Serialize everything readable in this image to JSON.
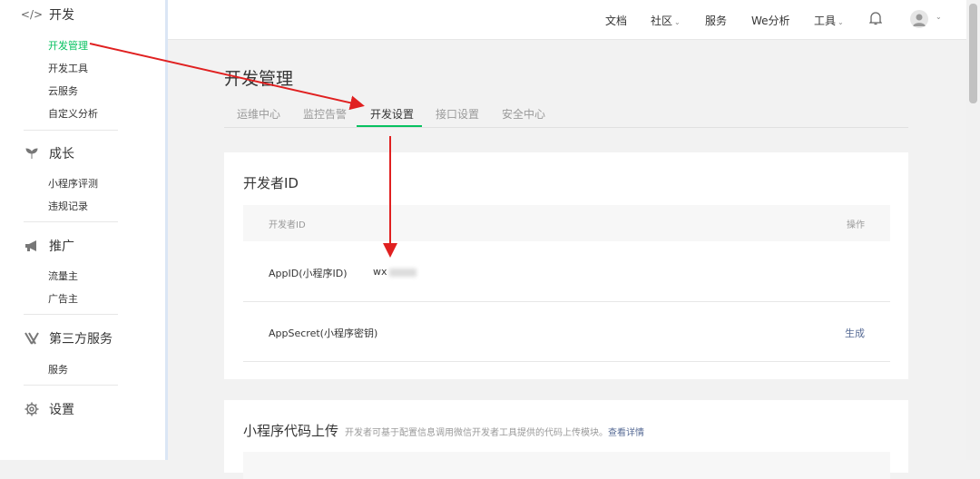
{
  "sidebar": {
    "sections": [
      {
        "title": "开发",
        "icon": "code-icon",
        "items": [
          "开发管理",
          "开发工具",
          "云服务",
          "自定义分析"
        ]
      },
      {
        "title": "成长",
        "icon": "sprout-icon",
        "items": [
          "小程序评测",
          "违规记录"
        ]
      },
      {
        "title": "推广",
        "icon": "megaphone-icon",
        "items": [
          "流量主",
          "广告主"
        ]
      },
      {
        "title": "第三方服务",
        "icon": "third-party-icon",
        "items": [
          "服务"
        ]
      },
      {
        "title": "设置",
        "icon": "gear-icon",
        "items": []
      }
    ],
    "active_item": "开发管理"
  },
  "topbar": {
    "items": [
      "文档",
      "社区",
      "服务",
      "We分析",
      "工具"
    ],
    "bell_icon": "bell-icon",
    "avatar_icon": "user-avatar-icon"
  },
  "page": {
    "title": "开发管理",
    "tabs": [
      "运维中心",
      "监控告警",
      "开发设置",
      "接口设置",
      "安全中心"
    ],
    "active_tab": "开发设置"
  },
  "dev_id_card": {
    "title": "开发者ID",
    "col_name": "开发者ID",
    "col_action": "操作",
    "rows": [
      {
        "label": "AppID(小程序ID)",
        "value": "wx",
        "action": ""
      },
      {
        "label": "AppSecret(小程序密钥)",
        "value": "",
        "action": "生成"
      }
    ]
  },
  "upload_card": {
    "title": "小程序代码上传",
    "desc": "开发者可基于配置信息调用微信开发者工具提供的代码上传模块。",
    "link": "查看详情"
  },
  "colors": {
    "accent": "#07c160",
    "link": "#576b95",
    "annotation": "#e02020"
  }
}
